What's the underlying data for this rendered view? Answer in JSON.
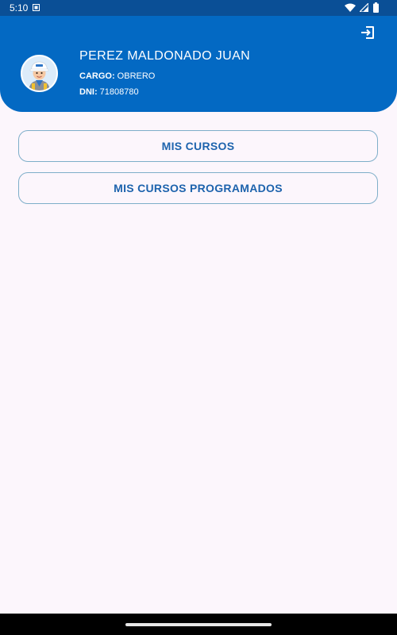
{
  "status_bar": {
    "time": "5:10",
    "icons": [
      "notification-icon",
      "wifi-icon",
      "signal-icon",
      "battery-icon"
    ]
  },
  "header": {
    "user_name": "PEREZ MALDONADO JUAN",
    "cargo_label": "CARGO:",
    "cargo_value": "OBRERO",
    "dni_label": "DNI:",
    "dni_value": "71808780",
    "logout_icon": "logout-icon",
    "avatar_icon": "worker-avatar"
  },
  "menu": {
    "mis_cursos": "MIS CURSOS",
    "mis_cursos_programados": "MIS CURSOS PROGRAMADOS"
  },
  "colors": {
    "status_bar_bg": "#0a4f96",
    "header_bg": "#0369c3",
    "page_bg": "#fcf6fc",
    "button_text": "#1d63ad",
    "button_border": "#7eaec9"
  }
}
